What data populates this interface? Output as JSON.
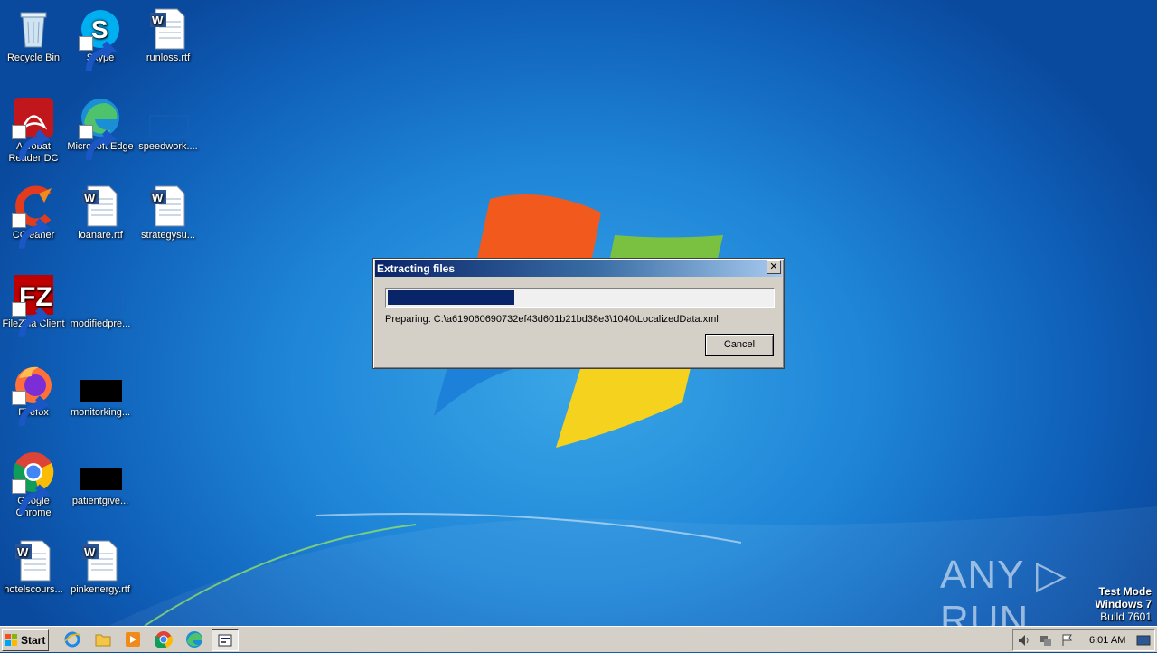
{
  "desktop": {
    "icons": [
      {
        "label": "Recycle Bin"
      },
      {
        "label": "Skype"
      },
      {
        "label": "runloss.rtf"
      },
      {
        "label": "Acrobat Reader DC"
      },
      {
        "label": "Microsoft Edge"
      },
      {
        "label": "speedwork...."
      },
      {
        "label": "CCleaner"
      },
      {
        "label": "loanare.rtf"
      },
      {
        "label": "strategysu..."
      },
      {
        "label": "FileZilla Client"
      },
      {
        "label": "modifiedpre..."
      },
      {
        "label": "Firefox"
      },
      {
        "label": "monitorking..."
      },
      {
        "label": "Google Chrome"
      },
      {
        "label": "patientgive..."
      },
      {
        "label": "hotelscours..."
      },
      {
        "label": "pinkenergy.rtf"
      }
    ]
  },
  "dialog": {
    "title": "Extracting files",
    "close_label": "✕",
    "progress_percent": 33,
    "status": "Preparing: C:\\a619060690732ef43d601b21bd38e3\\1040\\LocalizedData.xml",
    "cancel_label": "Cancel"
  },
  "watermark": {
    "text": "ANY ▷ RUN"
  },
  "system_info": {
    "line1": "Test Mode",
    "line2": "Windows 7",
    "line3": "Build 7601"
  },
  "taskbar": {
    "start_label": "Start",
    "clock": "6:01 AM"
  },
  "colors": {
    "title_active": "#0a246a",
    "progress": "#0a246a",
    "taskbar": "#d4d0c8"
  }
}
